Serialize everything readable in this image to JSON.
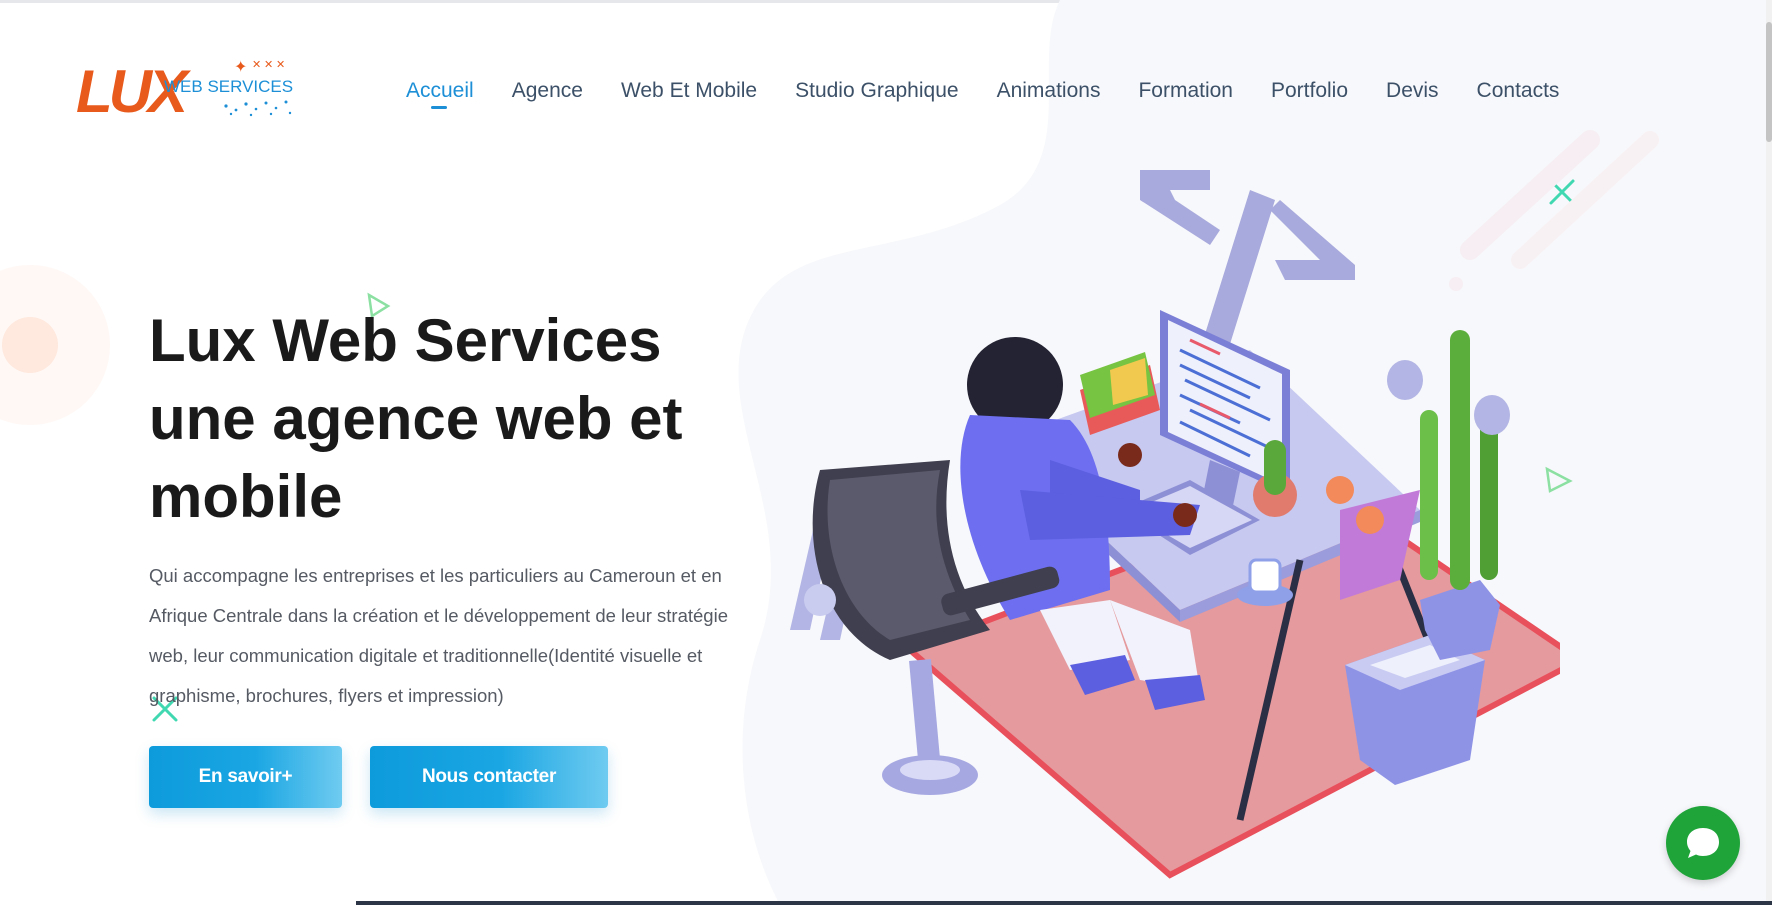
{
  "brand": {
    "logo_word": "LUX",
    "logo_sub": "WEB SERVICES",
    "colors": {
      "orange": "#e85a1c",
      "blue": "#1c8fd7"
    }
  },
  "nav": {
    "items": [
      {
        "label": "Accueil",
        "active": true
      },
      {
        "label": "Agence"
      },
      {
        "label": "Web Et Mobile"
      },
      {
        "label": "Studio Graphique"
      },
      {
        "label": "Animations"
      },
      {
        "label": "Formation"
      },
      {
        "label": "Portfolio"
      },
      {
        "label": "Devis"
      },
      {
        "label": "Contacts"
      }
    ]
  },
  "hero": {
    "title_lines": [
      "Lux Web Services",
      "une agence web et",
      "mobile"
    ],
    "description": "Qui accompagne les entreprises et les particuliers au Cameroun et en Afrique Centrale dans la création et le développement de leur stratégie web, leur communication digitale et traditionnelle(Identité visuelle et graphisme, brochures, flyers et impression)",
    "buttons": {
      "more": "En savoir+",
      "contact": "Nous contacter"
    }
  },
  "icons": {
    "chat": "chat-bubble-icon",
    "illustration": "developer-at-desk-illustration"
  }
}
